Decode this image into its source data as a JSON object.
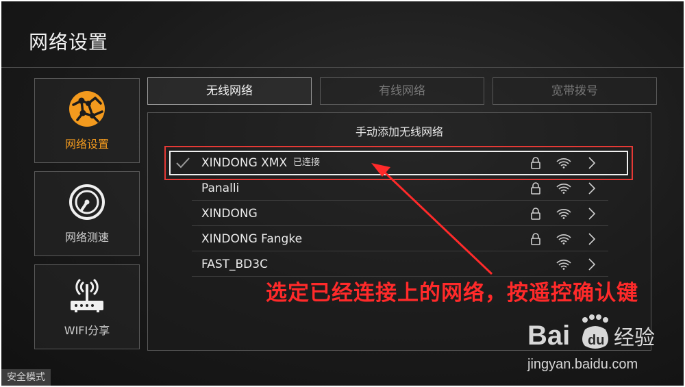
{
  "header": {
    "title": "网络设置"
  },
  "sidebar": {
    "items": [
      {
        "label": "网络设置",
        "icon": "globe-icon",
        "active": true
      },
      {
        "label": "网络测速",
        "icon": "speedometer-icon",
        "active": false
      },
      {
        "label": "WIFI分享",
        "icon": "router-icon",
        "active": false
      }
    ]
  },
  "tabs": [
    {
      "label": "无线网络",
      "active": true
    },
    {
      "label": "有线网络",
      "active": false
    },
    {
      "label": "宽带拨号",
      "active": false
    }
  ],
  "panel": {
    "manual_add": "手动添加无线网络",
    "networks": [
      {
        "ssid": "XINDONG XMX",
        "status": "已连接",
        "secured": true,
        "connected": true
      },
      {
        "ssid": "Panalli",
        "status": "",
        "secured": true,
        "connected": false
      },
      {
        "ssid": "XINDONG",
        "status": "",
        "secured": true,
        "connected": false
      },
      {
        "ssid": "XINDONG Fangke",
        "status": "",
        "secured": true,
        "connected": false
      },
      {
        "ssid": "FAST_BD3C",
        "status": "",
        "secured": false,
        "connected": false
      }
    ]
  },
  "annotation": {
    "text": "选定已经连接上的网络，按遥控确认键"
  },
  "footer": {
    "safe_mode": "安全模式"
  },
  "watermark": {
    "url": "jingyan.baidu.com",
    "logo_text": "Bai经验"
  },
  "colors": {
    "accent": "#f39a1e",
    "annotation": "#ff2a2a",
    "background": "#1a1a1a"
  }
}
